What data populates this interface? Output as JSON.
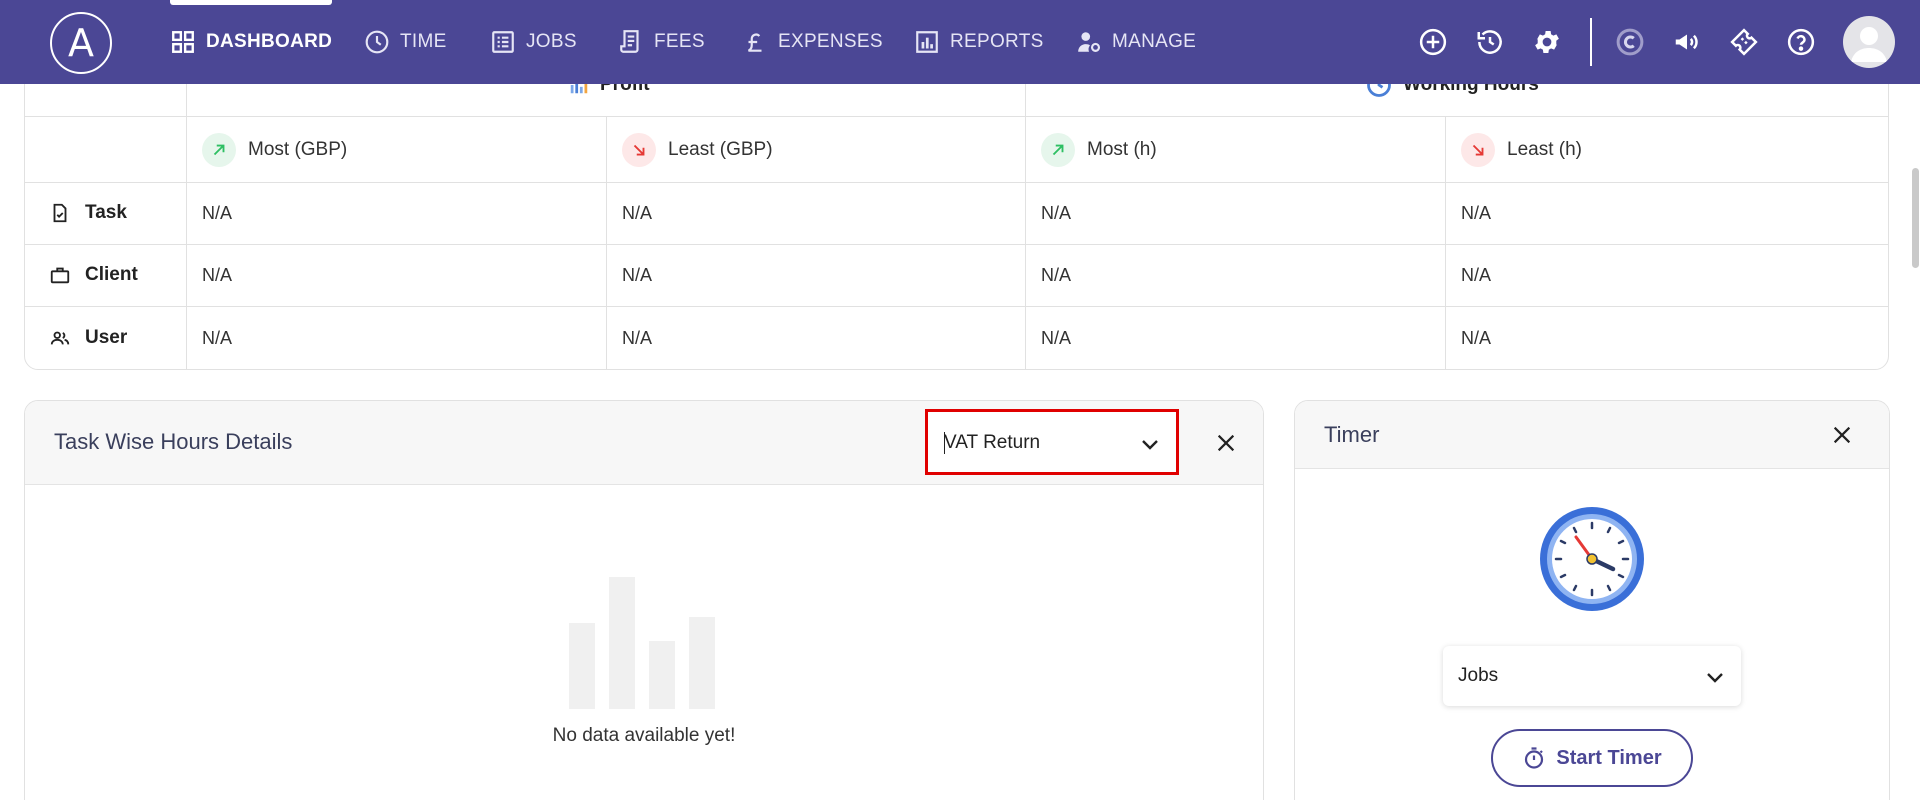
{
  "nav": {
    "logo_letter": "A",
    "items": [
      {
        "label": "DASHBOARD",
        "icon": "grid-icon",
        "active": true
      },
      {
        "label": "TIME",
        "icon": "clock-icon"
      },
      {
        "label": "JOBS",
        "icon": "list-icon"
      },
      {
        "label": "FEES",
        "icon": "receipt-icon"
      },
      {
        "label": "EXPENSES",
        "icon": "pound-icon"
      },
      {
        "label": "REPORTS",
        "icon": "bar-chart-icon"
      },
      {
        "label": "MANAGE",
        "icon": "user-gear-icon"
      }
    ],
    "right_icons": [
      "add-circle-icon",
      "history-icon",
      "settings-gear-icon",
      "c-brand-icon",
      "megaphone-icon",
      "ticket-icon",
      "help-icon",
      "user-avatar-icon"
    ]
  },
  "summary": {
    "groups": [
      {
        "title": "Profit",
        "icon": "profit-chart-icon"
      },
      {
        "title": "Working Hours",
        "icon": "working-hours-icon"
      }
    ],
    "columns": [
      {
        "label": "Most (GBP)",
        "trend": "up"
      },
      {
        "label": "Least (GBP)",
        "trend": "down"
      },
      {
        "label": "Most (h)",
        "trend": "up"
      },
      {
        "label": "Least (h)",
        "trend": "down"
      }
    ],
    "rows": [
      {
        "label": "Task",
        "icon": "task-file-icon",
        "values": [
          "N/A",
          "N/A",
          "N/A",
          "N/A"
        ]
      },
      {
        "label": "Client",
        "icon": "briefcase-icon",
        "values": [
          "N/A",
          "N/A",
          "N/A",
          "N/A"
        ]
      },
      {
        "label": "User",
        "icon": "users-icon",
        "values": [
          "N/A",
          "N/A",
          "N/A",
          "N/A"
        ]
      }
    ]
  },
  "task_card": {
    "title": "Task Wise Hours Details",
    "selected_task": "VAT Return",
    "empty_message": "No data available yet!"
  },
  "timer_card": {
    "title": "Timer",
    "jobs_select": "Jobs",
    "start_label": "Start Timer"
  },
  "colors": {
    "nav_bg": "#4b4795",
    "highlight_border": "#e00000",
    "trend_up": "#2ebf63",
    "trend_down": "#e53935"
  }
}
